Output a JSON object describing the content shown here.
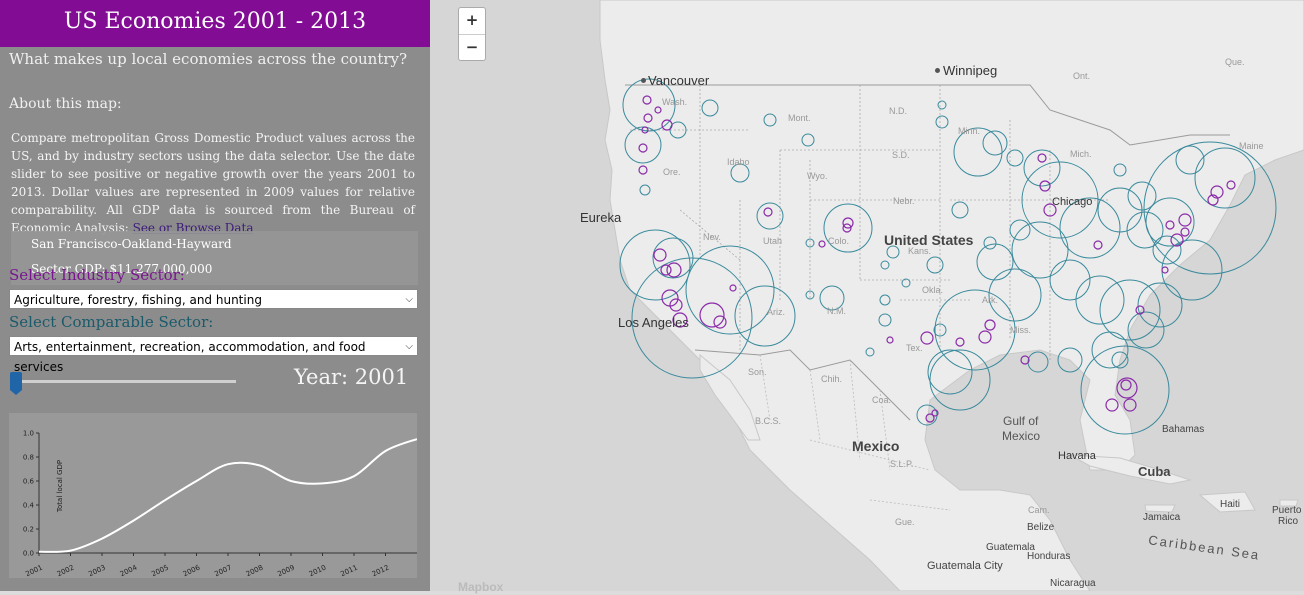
{
  "sidebar": {
    "title": "US Economies 2001 - 2013",
    "subtitle": "What makes up local economies across the country?",
    "about_heading": "About this map:",
    "about_text": "Compare metropolitan Gross Domestic Product values across the US, and by industry sectors using the data selector. Use the date slider to see positive or negative growth over the years 2001 to 2013. Dollar values are represented in 2009 values for relative comparability. All GDP data is sourced from the Bureau of Economic Analysis: ",
    "about_link": "See or Browse Data",
    "tooltip": {
      "metro_name": "San Francisco-Oakland-Hayward",
      "sector_gdp": "Sector GDP: $11,277,000,000"
    },
    "industry_label": "Select Industry Sector:",
    "industry_selected": "Agriculture, forestry, fishing, and hunting",
    "comparable_label": "Select Comparable Sector:",
    "comparable_selected": "Arts, entertainment, recreation, accommodation, and food services",
    "slider_value": 2001,
    "year_label": "Year: 2001"
  },
  "chart_data": {
    "type": "line",
    "ylabel": "Total local GDP",
    "ylim": [
      0,
      1.0
    ],
    "y_ticks": [
      "0.0",
      "0.2",
      "0.4",
      "0.6",
      "0.8",
      "1.0"
    ],
    "x_ticks": [
      "2001",
      "2002",
      "2003",
      "2004",
      "2005",
      "2006",
      "2007",
      "2008",
      "2009",
      "2010",
      "2011",
      "2012"
    ],
    "x": [
      2001,
      2002,
      2003,
      2004,
      2005,
      2006,
      2007,
      2008,
      2009,
      2010,
      2011,
      2012,
      2013
    ],
    "values": [
      0.01,
      0.02,
      0.12,
      0.27,
      0.44,
      0.6,
      0.74,
      0.73,
      0.6,
      0.58,
      0.64,
      0.85,
      0.95
    ]
  },
  "map": {
    "zoom_in": "+",
    "zoom_out": "−",
    "attribution": "Mapbox",
    "colors": {
      "teal": "#3a8a9c",
      "purple": "#8a2aa8"
    },
    "labels": {
      "vancouver": "Vancouver",
      "winnipeg": "Winnipeg",
      "eureka": "Eureka",
      "los_angeles": "Los Angeles",
      "united_states": "United States",
      "mexico": "Mexico",
      "gulf": "Gulf of",
      "gulf2": "Mexico",
      "havana": "Havana",
      "cuba": "Cuba",
      "bahamas": "Bahamas",
      "caribbean": "Caribbean Sea",
      "jamaica": "Jamaica",
      "haiti": "Haiti",
      "puerto": "Puerto",
      "rico": "Rico",
      "belize": "Belize",
      "guatemala": "Guatemala",
      "guatemala_city": "Guatemala City",
      "honduras": "Honduras",
      "nicaragua": "Nicaragua",
      "chicago": "Chicago",
      "ont": "Ont.",
      "que": "Que.",
      "wash": "Wash.",
      "ore": "Ore.",
      "idaho": "Idaho",
      "mont": "Mont.",
      "wyo": "Wyo.",
      "nev": "Nev.",
      "utah": "Utah",
      "colo": "Colo.",
      "ariz": "Ariz.",
      "nm": "N.M.",
      "nd": "N.D.",
      "sd": "S.D.",
      "nebr": "Nebr.",
      "kans": "Kans.",
      "okla": "Okla.",
      "tex": "Tex.",
      "minn": "Minn.",
      "mich": "Mich.",
      "maine": "Maine",
      "ark": "Ark.",
      "miss": "Miss.",
      "son": "Son.",
      "chih": "Chih.",
      "coa": "Coa.",
      "bcs": "B.C.S.",
      "slp": "S.L.P.",
      "gue": "Gue.",
      "cam": "Cam."
    }
  }
}
